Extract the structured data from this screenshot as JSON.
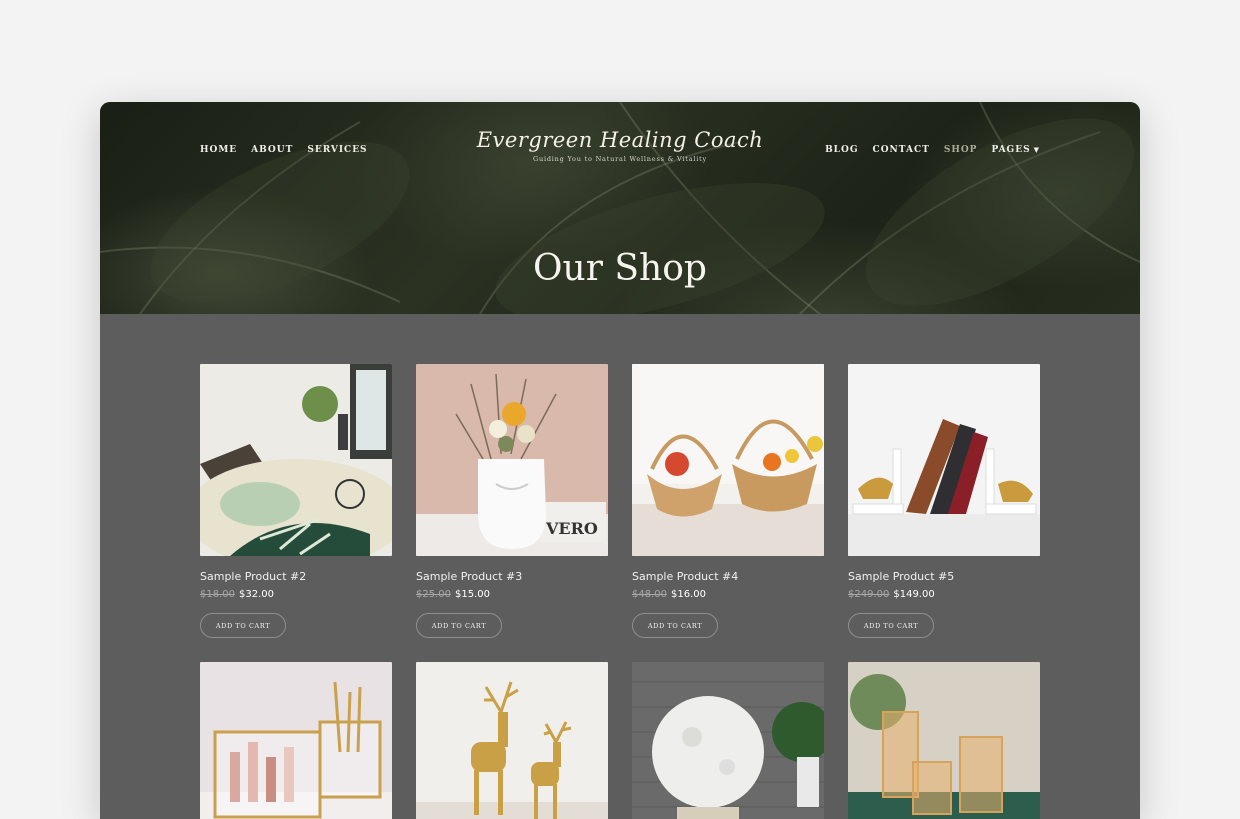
{
  "nav": {
    "left": [
      {
        "label": "HOME"
      },
      {
        "label": "ABOUT"
      },
      {
        "label": "SERVICES"
      }
    ],
    "right": [
      {
        "label": "BLOG"
      },
      {
        "label": "CONTACT"
      },
      {
        "label": "SHOP",
        "active": true
      },
      {
        "label": "PAGES"
      }
    ]
  },
  "brand": {
    "name": "Evergreen Healing Coach",
    "tagline": "Guiding You to Natural Wellness & Vitality"
  },
  "hero": {
    "title": "Our Shop"
  },
  "products": [
    {
      "name": "Sample Product #2",
      "old_price": "$18.00",
      "price": "$32.00",
      "button": "ADD TO CART",
      "image": "round rug in living room"
    },
    {
      "name": "Sample Product #3",
      "old_price": "$25.00",
      "price": "$15.00",
      "button": "ADD TO CART",
      "image": "face vase with flowers"
    },
    {
      "name": "Sample Product #4",
      "old_price": "$48.00",
      "price": "$16.00",
      "button": "ADD TO CART",
      "image": "apple shaped fruit baskets"
    },
    {
      "name": "Sample Product #5",
      "old_price": "$249.00",
      "price": "$149.00",
      "button": "ADD TO CART",
      "image": "bookends with books"
    },
    {
      "name": "",
      "image": "gold makeup organizer"
    },
    {
      "name": "",
      "image": "gold deer figurines"
    },
    {
      "name": "",
      "image": "moon lamp"
    },
    {
      "name": "",
      "image": "gold candle holders"
    }
  ]
}
